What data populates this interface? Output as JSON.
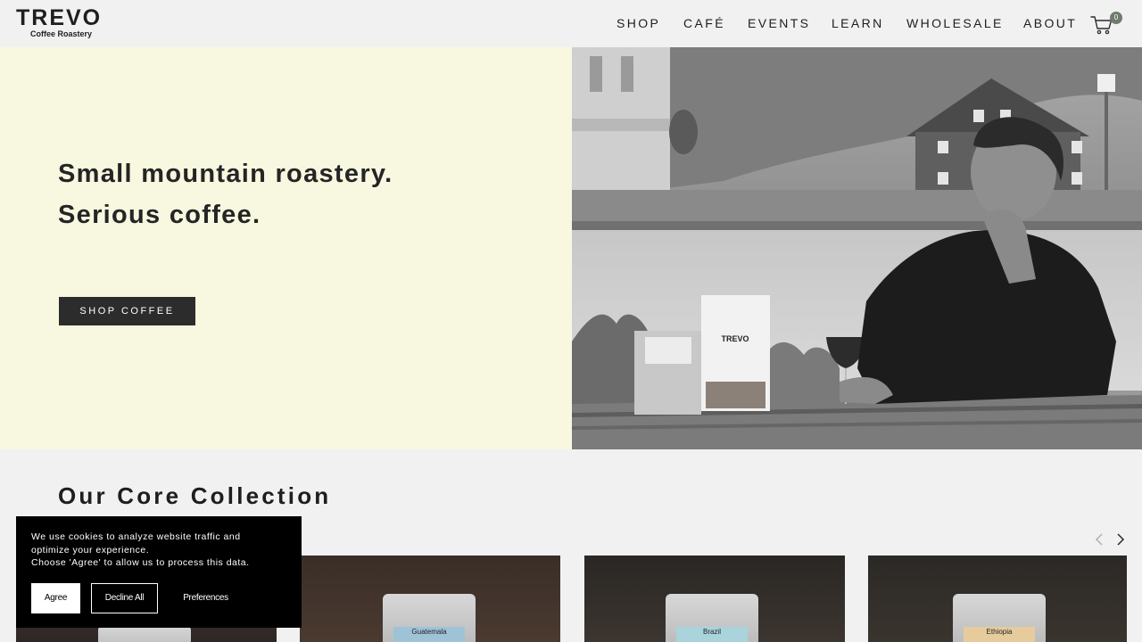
{
  "brand": {
    "name": "TREVO",
    "tagline": "Coffee Roastery"
  },
  "nav": {
    "items": [
      "SHOP",
      "CAFÉ",
      "EVENTS",
      "LEARN",
      "WHOLESALE",
      "ABOUT"
    ]
  },
  "cart": {
    "icon": "cart-icon",
    "count": "0"
  },
  "hero": {
    "title_line1": "Small mountain roastery.",
    "title_line2": "Serious coffee.",
    "cta_label": "SHOP COFFEE",
    "image_box_brand": "TREVO"
  },
  "collection": {
    "title": "Our Core Collection",
    "prev_icon": "chevron-left-icon",
    "next_icon": "chevron-right-icon",
    "products": [
      {
        "label": ""
      },
      {
        "label": "Guatemala"
      },
      {
        "label": "Brazil"
      },
      {
        "label": "Ethiopia"
      }
    ]
  },
  "cookie_banner": {
    "text_line1": "We use cookies to analyze website traffic and",
    "text_line2": "optimize your experience.",
    "text_line3": "Choose 'Agree' to allow us to process this data.",
    "agree_label": "Agree",
    "decline_label": "Decline All",
    "preferences_label": "Preferences"
  },
  "colors": {
    "hero_bg": "#f8f8e1",
    "button_dark": "#2c2c2c",
    "page_bg": "#f1f1f1",
    "badge": "#6f7c6d"
  }
}
